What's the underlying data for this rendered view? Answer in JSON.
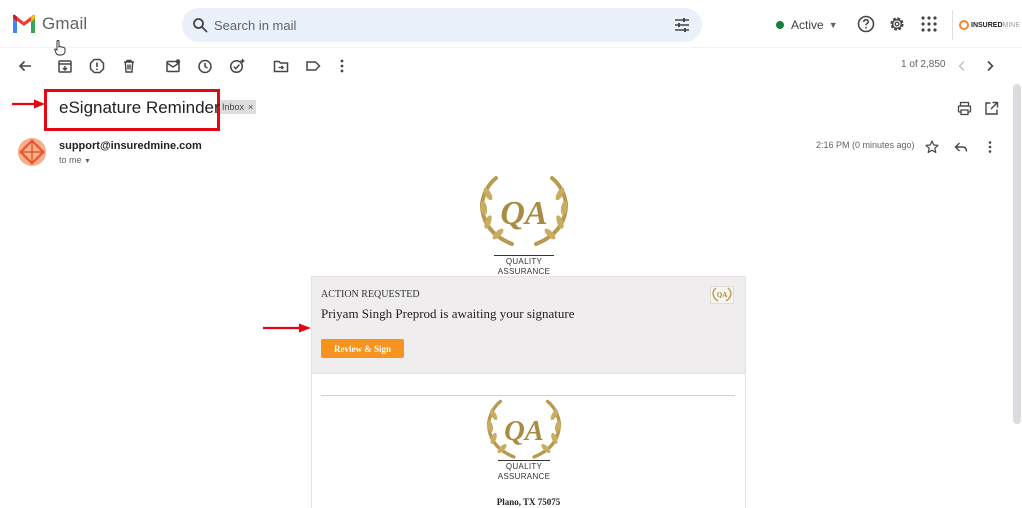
{
  "app": {
    "name": "Gmail"
  },
  "search": {
    "placeholder": "Search in mail"
  },
  "status": {
    "label": "Active",
    "color": "#188038"
  },
  "account_brand": {
    "strong": "INSURED",
    "light": "MINE"
  },
  "toolbar": {
    "icons": [
      "back-arrow-icon",
      "archive-icon",
      "report-spam-icon",
      "delete-icon",
      "mark-unread-icon",
      "snooze-icon",
      "add-to-tasks-icon",
      "move-to-icon",
      "label-icon",
      "more-vert-icon"
    ],
    "pager": "1 of 2,850"
  },
  "email": {
    "subject": "eSignature Reminder",
    "label_chip": "Inbox",
    "sender": "support@insuredmine.com",
    "recipient": "to me",
    "time": "2:16 PM (0 minutes ago)"
  },
  "body": {
    "qa_line1": "QUALITY",
    "qa_line2": "ASSURANCE",
    "action_requested": "ACTION REQUESTED",
    "message": "Priyam Singh Preprod is awaiting your signature",
    "button": "Review & Sign",
    "address": "Plano, TX 75075"
  },
  "colors": {
    "annotation_red": "#e30613",
    "button_orange": "#f7931e",
    "emblem_gold": "#b89a4e"
  }
}
